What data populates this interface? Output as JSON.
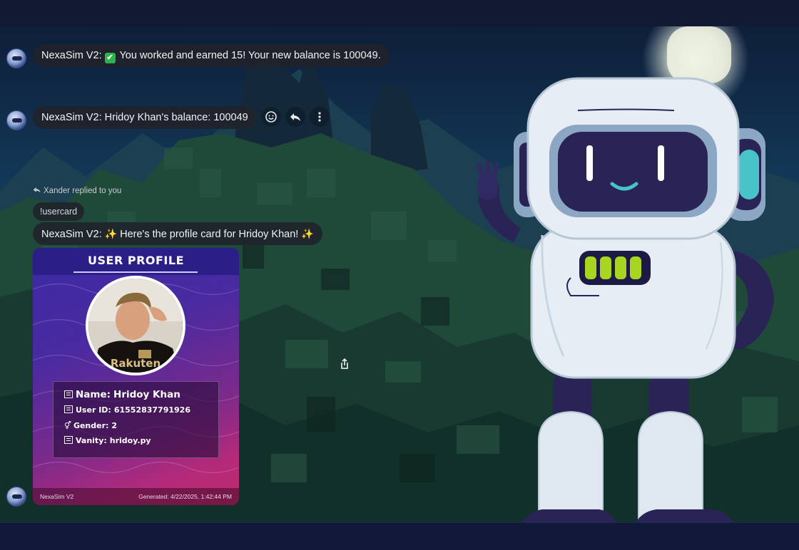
{
  "messages": [
    {
      "sender": "NexaSim V2:",
      "emoji": "✔",
      "text": "You worked and earned 15! Your new balance is 100049."
    },
    {
      "sender": "NexaSim V2:",
      "text": "Hridoy Khan's balance: 100049"
    }
  ],
  "message_actions": {
    "react_icon": "smiley-icon",
    "reply_icon": "reply-icon",
    "more_icon": "more-vertical-icon"
  },
  "reply_context": {
    "text": "Xander replied to you",
    "quoted": "!usercard"
  },
  "card_message": {
    "sender": "NexaSim V2:",
    "text": "Here's the profile card for Hridoy Khan!",
    "sparkle": "✨"
  },
  "profile_card": {
    "title": "USER PROFILE",
    "photo_text": "Rakuten",
    "fields": [
      {
        "label": "Name:",
        "value": "Hridoy Khan"
      },
      {
        "label": "User ID:",
        "value": "61552837791926"
      },
      {
        "label": "Gender:",
        "value": "2"
      },
      {
        "label": "Vanity:",
        "value": "hridoy.py"
      }
    ],
    "footer_left": "NexaSim V2",
    "footer_right": "Generated: 4/22/2025, 1:42:44 PM"
  },
  "colors": {
    "bubble": "#20222a",
    "card_top": "#3b2aa6",
    "card_bottom": "#c12a6a",
    "check": "#2cb34a"
  }
}
